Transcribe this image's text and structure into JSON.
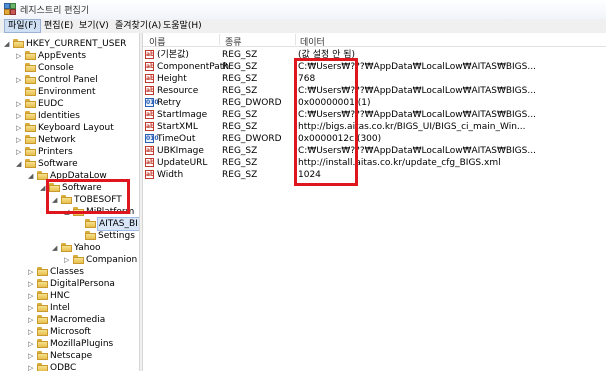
{
  "window": {
    "title": "레지스트리 편집기"
  },
  "menu": [
    {
      "label": "파일(F)",
      "active": true
    },
    {
      "label": "편집(E)",
      "active": false
    },
    {
      "label": "보기(V)",
      "active": false
    },
    {
      "label": "즐겨찾기(A)",
      "active": false
    },
    {
      "label": "도움말(H)",
      "active": false
    }
  ],
  "tree": [
    {
      "label": "HKEY_CURRENT_USER",
      "level": 0,
      "exp": "◢"
    },
    {
      "label": "AppEvents",
      "level": 1,
      "exp": "▷"
    },
    {
      "label": "Console",
      "level": 1,
      "exp": ""
    },
    {
      "label": "Control Panel",
      "level": 1,
      "exp": "▷"
    },
    {
      "label": "Environment",
      "level": 1,
      "exp": ""
    },
    {
      "label": "EUDC",
      "level": 1,
      "exp": "▷"
    },
    {
      "label": "Identities",
      "level": 1,
      "exp": "▷"
    },
    {
      "label": "Keyboard Layout",
      "level": 1,
      "exp": "▷"
    },
    {
      "label": "Network",
      "level": 1,
      "exp": "▷"
    },
    {
      "label": "Printers",
      "level": 1,
      "exp": "▷"
    },
    {
      "label": "Software",
      "level": 1,
      "exp": "◢"
    },
    {
      "label": "AppDataLow",
      "level": 2,
      "exp": "◢"
    },
    {
      "label": "Software",
      "level": 3,
      "exp": "◢"
    },
    {
      "label": "TOBESOFT",
      "level": 4,
      "exp": "◢"
    },
    {
      "label": "MiPlatform",
      "level": 5,
      "exp": "◢"
    },
    {
      "label": "AITAS_BI",
      "level": 6,
      "exp": "",
      "selected": true
    },
    {
      "label": "Settings",
      "level": 6,
      "exp": ""
    },
    {
      "label": "Yahoo",
      "level": 4,
      "exp": "◢"
    },
    {
      "label": "Companion",
      "level": 5,
      "exp": "▷"
    },
    {
      "label": "Classes",
      "level": 2,
      "exp": "▷"
    },
    {
      "label": "DigitalPersona",
      "level": 2,
      "exp": "▷"
    },
    {
      "label": "HNC",
      "level": 2,
      "exp": "▷"
    },
    {
      "label": "Intel",
      "level": 2,
      "exp": "▷"
    },
    {
      "label": "Macromedia",
      "level": 2,
      "exp": "▷"
    },
    {
      "label": "Microsoft",
      "level": 2,
      "exp": "▷"
    },
    {
      "label": "MozillaPlugins",
      "level": 2,
      "exp": "▷"
    },
    {
      "label": "Netscape",
      "level": 2,
      "exp": "▷"
    },
    {
      "label": "ODBC",
      "level": 2,
      "exp": "▷"
    }
  ],
  "list": {
    "columns": {
      "name": "이름",
      "type": "종류",
      "data": "데이터"
    },
    "rows": [
      {
        "name": "(기본값)",
        "type": "REG_SZ",
        "data": "(값 설정 안 됨)",
        "icon": "sz"
      },
      {
        "name": "ComponentPath",
        "type": "REG_SZ",
        "data": "C:₩Users₩???₩AppData₩LocalLow₩AITAS₩BIGS...",
        "icon": "sz"
      },
      {
        "name": "Height",
        "type": "REG_SZ",
        "data": "768",
        "icon": "sz"
      },
      {
        "name": "Resource",
        "type": "REG_SZ",
        "data": "C:₩Users₩???₩AppData₩LocalLow₩AITAS₩BIGS...",
        "icon": "sz"
      },
      {
        "name": "Retry",
        "type": "REG_DWORD",
        "data": "0x00000001 (1)",
        "icon": "dw"
      },
      {
        "name": "StartImage",
        "type": "REG_SZ",
        "data": "C:₩Users₩???₩AppData₩LocalLow₩AITAS₩BIGS...",
        "icon": "sz"
      },
      {
        "name": "StartXML",
        "type": "REG_SZ",
        "data": "http://bigs.aitas.co.kr/BIGS_UI/BIGS_ci_main_Win...",
        "icon": "sz"
      },
      {
        "name": "TimeOut",
        "type": "REG_DWORD",
        "data": "0x0000012c (300)",
        "icon": "dw"
      },
      {
        "name": "UBKImage",
        "type": "REG_SZ",
        "data": "C:₩Users₩???₩AppData₩LocalLow₩AITAS₩BIGS...",
        "icon": "sz"
      },
      {
        "name": "UpdateURL",
        "type": "REG_SZ",
        "data": "http://install.aitas.co.kr/update_cfg_BIGS.xml",
        "icon": "sz"
      },
      {
        "name": "Width",
        "type": "REG_SZ",
        "data": "1024",
        "icon": "sz"
      }
    ]
  },
  "icons": {
    "string_value": "ab",
    "dword_value": "010"
  },
  "colors": {
    "highlight_box": "#e0161f",
    "selection": "#d8e6f8",
    "folder": "#e7bf4f"
  }
}
